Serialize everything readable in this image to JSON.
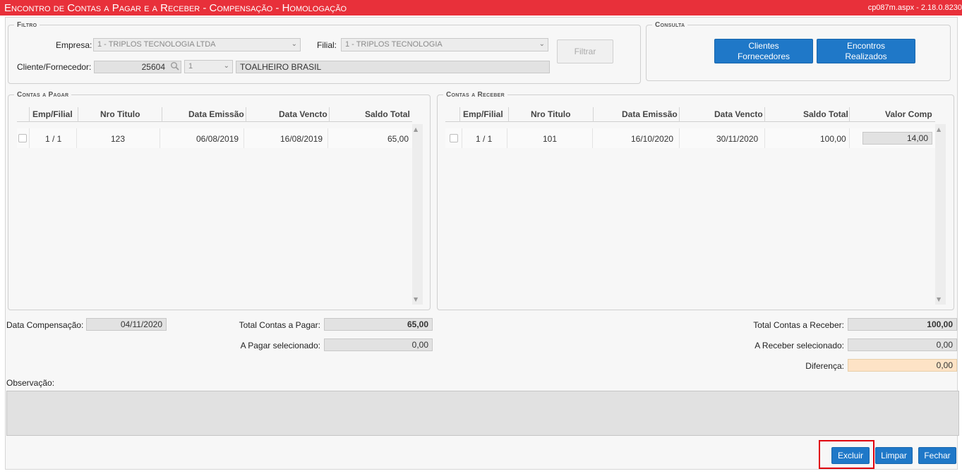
{
  "header": {
    "title": "Encontro de Contas a Pagar e a Receber - Compensação  - Homologação",
    "version": "cp087m.aspx - 2.18.0.8230"
  },
  "filtro": {
    "legend": "Filtro",
    "empresa_label": "Empresa:",
    "empresa_value": "1 - TRIPLOS TECNOLOGIA LTDA",
    "filial_label": "Filial:",
    "filial_value": "1 - TRIPLOS TECNOLOGIA",
    "filtrar_button": "Filtrar",
    "cliente_label": "Cliente/Fornecedor:",
    "cliente_code": "25604",
    "cliente_type": "1",
    "cliente_name": "TOALHEIRO BRASIL"
  },
  "consulta": {
    "legend": "Consulta",
    "btn_clientes_line1": "Clientes",
    "btn_clientes_line2": "Fornecedores",
    "btn_encontros_line1": "Encontros",
    "btn_encontros_line2": "Realizados"
  },
  "pagar": {
    "legend": "Contas a Pagar",
    "columns": [
      "Emp/Filial",
      "Nro Titulo",
      "Data Emissão",
      "Data Vencto",
      "Saldo Total"
    ],
    "rows": [
      {
        "emp_filial": "1 / 1",
        "nro_titulo": "123",
        "data_emissao": "06/08/2019",
        "data_vencto": "16/08/2019",
        "saldo_total": "65,00"
      }
    ]
  },
  "receber": {
    "legend": "Contas a Receber",
    "columns": [
      "Emp/Filial",
      "Nro Titulo",
      "Data Emissão",
      "Data Vencto",
      "Saldo Total",
      "Valor Comp"
    ],
    "rows": [
      {
        "emp_filial": "1 / 1",
        "nro_titulo": "101",
        "data_emissao": "16/10/2020",
        "data_vencto": "30/11/2020",
        "saldo_total": "100,00",
        "valor_comp": "14,00"
      }
    ]
  },
  "totals": {
    "data_comp_label": "Data Compensação:",
    "data_comp_value": "04/11/2020",
    "total_pagar_label": "Total Contas a Pagar:",
    "total_pagar_value": "65,00",
    "pagar_sel_label": "A Pagar selecionado:",
    "pagar_sel_value": "0,00",
    "total_receber_label": "Total Contas a Receber:",
    "total_receber_value": "100,00",
    "receber_sel_label": "A Receber selecionado:",
    "receber_sel_value": "0,00",
    "diferenca_label": "Diferença:",
    "diferenca_value": "0,00"
  },
  "observacao_label": "Observação:",
  "actions": {
    "excluir": "Excluir",
    "limpar": "Limpar",
    "fechar": "Fechar"
  },
  "colors": {
    "title_bar": "#e8303a",
    "button_blue": "#1f78c8",
    "highlight_red": "#e0000f",
    "diferenca_bg": "#fde3c6"
  }
}
